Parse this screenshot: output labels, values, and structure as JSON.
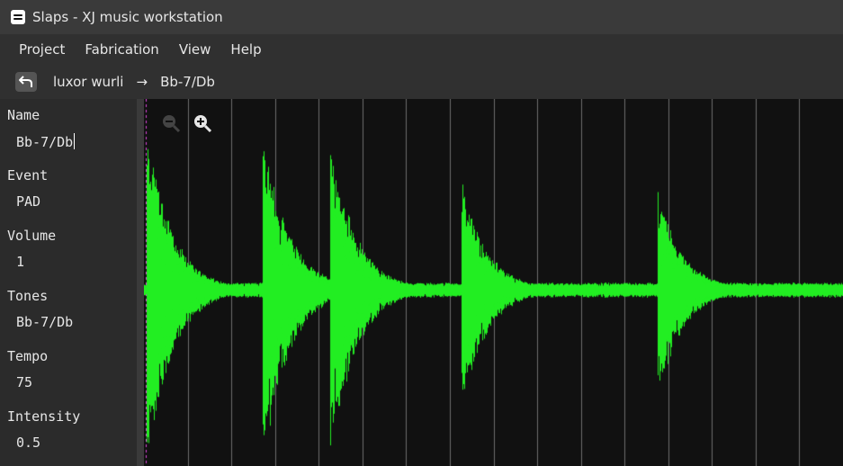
{
  "window": {
    "title": "Slaps - XJ music workstation"
  },
  "menu": {
    "items": [
      "Project",
      "Fabrication",
      "View",
      "Help"
    ]
  },
  "breadcrumb": {
    "parent": "luxor wurli",
    "arrow": "→",
    "current": "Bb-7/Db"
  },
  "properties": [
    {
      "label": "Name",
      "value": "Bb-7/Db",
      "editing": true
    },
    {
      "label": "Event",
      "value": "PAD"
    },
    {
      "label": "Volume",
      "value": "1"
    },
    {
      "label": "Tones",
      "value": "Bb-7/Db"
    },
    {
      "label": "Tempo",
      "value": "75"
    },
    {
      "label": "Intensity",
      "value": "0.5"
    }
  ],
  "waveform": {
    "color": "#22ee22",
    "background": "#111111",
    "grid_color": "#bbbbbb",
    "playhead_color": "#dd44dd",
    "beat_count": 16,
    "onsets": [
      0.0,
      0.165,
      0.262,
      0.45,
      0.73
    ],
    "peak_amplitudes": [
      0.92,
      0.96,
      0.88,
      0.62,
      0.57
    ]
  },
  "zoom": {
    "out_icon": "zoom-out-icon",
    "in_icon": "zoom-in-icon"
  }
}
